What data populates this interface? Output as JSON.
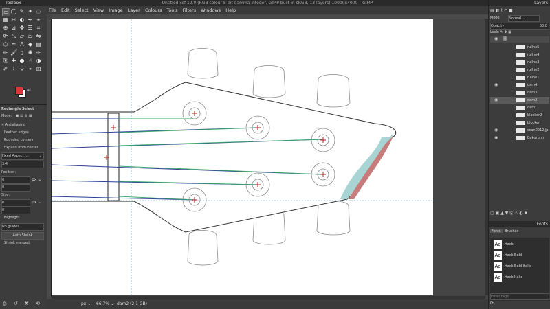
{
  "toolbox": {
    "title": "Toolbox -",
    "tool_name": "Rectangle Select",
    "mode_label": "Mode:",
    "options": {
      "antialiasing": "Antialiasing",
      "feather_edges": "Feather edges",
      "rounded_corners": "Rounded corners",
      "expand_from_center": "Expand from center",
      "fixed_aspect": "Fixed Aspect r...",
      "aspect_value": "3:4",
      "position_label": "Position:",
      "pos_unit": "px",
      "pos_x": "0",
      "pos_y": "0",
      "size_label": "Size:",
      "size_unit": "px",
      "size_w": "0",
      "size_h": "0",
      "highlight": "Highlight",
      "guides": "No guides",
      "auto_shrink": "Auto Shrink",
      "shrink_merged": "Shrink merged"
    },
    "fg_color": "#d9373a",
    "bg_color": "#ffffff"
  },
  "image_window": {
    "title": "Untitled.xcf-12.0 (RGB colour 8-bit gamma integer, GIMP built-in sRGB, 13 layers) 10000x4000 – GIMP",
    "menu": [
      "File",
      "Edit",
      "Select",
      "View",
      "Image",
      "Layer",
      "Colours",
      "Tools",
      "Filters",
      "Windows",
      "Help"
    ],
    "status": {
      "unit": "px",
      "zoom": "66.7%",
      "layer_info": "dam2 (2.1 GB)"
    }
  },
  "layers_panel": {
    "title": "Layers",
    "mode_label": "Mode",
    "mode_value": "Normal",
    "opacity_label": "Opacity",
    "opacity_value": "60.0",
    "lock_label": "Lock:",
    "layers": [
      {
        "name": "rullne5",
        "visible": false
      },
      {
        "name": "rullne4",
        "visible": false
      },
      {
        "name": "rullne3",
        "visible": false
      },
      {
        "name": "rullne2",
        "visible": false
      },
      {
        "name": "rullne1",
        "visible": false
      },
      {
        "name": "dam4",
        "visible": true
      },
      {
        "name": "dam3",
        "visible": false
      },
      {
        "name": "dam2",
        "visible": true
      },
      {
        "name": "dam",
        "visible": false
      },
      {
        "name": "blocker2",
        "visible": false
      },
      {
        "name": "blocker",
        "visible": false
      },
      {
        "name": "scan0012.jp",
        "visible": true
      },
      {
        "name": "Bakgrunn",
        "visible": true
      }
    ]
  },
  "fonts_panel": {
    "title": "Fonts",
    "tab_fonts": "Fonts",
    "tab_brushes": "Brushes",
    "fonts": [
      "Hack",
      "Hack Bold",
      "Hack Bold Italic",
      "Hack Italic"
    ],
    "preview": "Aa",
    "filter_placeholder": "Enter tags"
  },
  "colors": {
    "teal": "#a9d4d4",
    "red": "#c77b7b",
    "green_string": "#3aa56a",
    "blue_string": "#2a3f9a"
  }
}
